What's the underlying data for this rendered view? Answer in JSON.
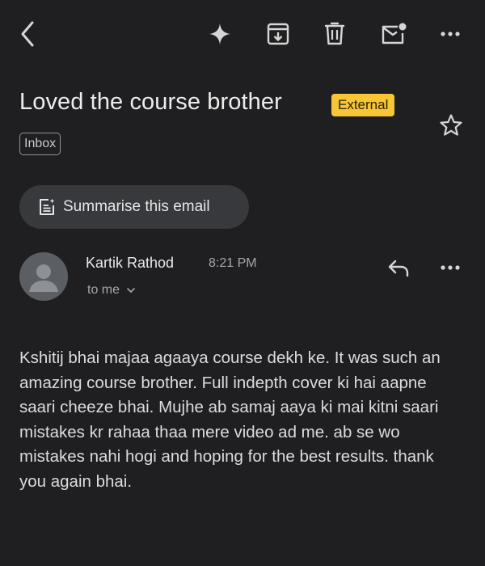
{
  "toolbar": {
    "back": "back-icon",
    "actions": [
      "sparkle-icon",
      "archive-icon",
      "delete-icon",
      "mark-unread-icon",
      "more-icon"
    ]
  },
  "email": {
    "subject": "Loved the course brother",
    "external_badge": "External",
    "label": "Inbox",
    "summarise_label": "Summarise this email",
    "sender_name": "Kartik Rathod",
    "time": "8:21 PM",
    "recipient": "to me",
    "body": "Kshitij bhai majaa agaaya course dekh ke. It was such an amazing course brother. Full indepth cover ki hai aapne saari cheeze bhai. Mujhe ab samaj aaya ki mai kitni saari mistakes kr rahaa thaa mere video ad me. ab se wo mistakes nahi hogi and hoping for the best results. thank you again bhai."
  },
  "colors": {
    "background": "#1f1f21",
    "external_badge": "#f7c634",
    "summarise_button": "#37393c",
    "avatar": "#5b5e63"
  }
}
